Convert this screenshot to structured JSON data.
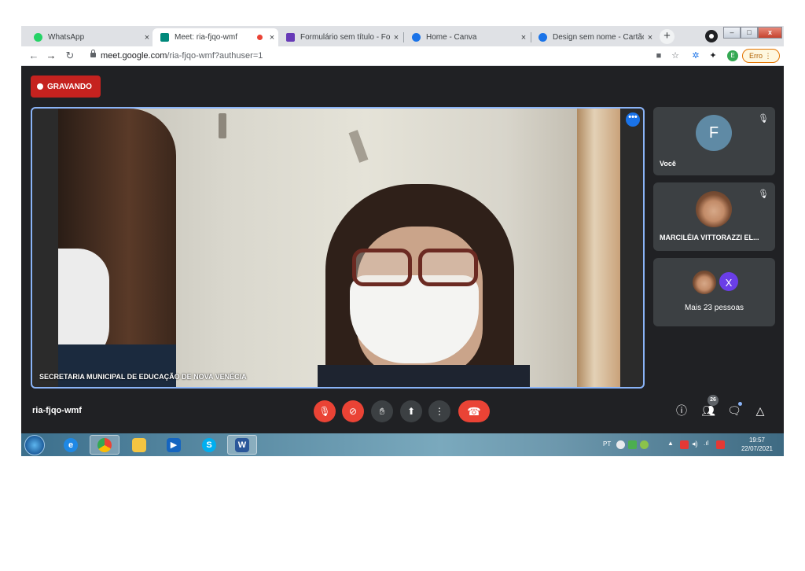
{
  "browser": {
    "tabs": [
      {
        "title": "WhatsApp",
        "icon": "whatsapp-icon",
        "color": "#25d366"
      },
      {
        "title": "Meet: ria-fjqo-wmf",
        "icon": "meet-icon",
        "color": "#00897b",
        "recording": true
      },
      {
        "title": "Formulário sem título - Formul",
        "icon": "forms-icon",
        "color": "#673ab7"
      },
      {
        "title": "Home - Canva",
        "icon": "canva-icon",
        "color": "#00c4cc"
      },
      {
        "title": "Design sem nome - Cartão",
        "icon": "canva-icon",
        "color": "#00c4cc"
      }
    ],
    "close_glyph": "×",
    "new_tab_glyph": "+",
    "window_controls": {
      "minimize": "–",
      "maximize": "□",
      "close": "x"
    },
    "url_host": "meet.google.com",
    "url_path": "/ria-fjqo-wmf?authuser=1",
    "profile_initial": "E",
    "error_chip": "Erro"
  },
  "meet": {
    "recording_label": "GRAVANDO",
    "main_tile_name": "SECRETARIA MUNICIPAL DE EDUCAÇÃO DE NOVA VENÉCIA",
    "main_tile_menu_glyph": "•••",
    "side_tiles": [
      {
        "name": "Você",
        "initial": "F"
      },
      {
        "name": "MARCILÉIA VITTORAZZI EL..."
      },
      {
        "name": "Mais 23 pessoas",
        "initial": "X"
      }
    ],
    "meeting_code": "ria-fjqo-wmf",
    "participant_count": "26",
    "controls": {
      "mic": "mic-off-icon",
      "camera": "camera-off-icon",
      "raise_hand": "raise-hand-icon",
      "present": "present-screen-icon",
      "more": "more-vert-icon",
      "hangup": "hangup-icon"
    },
    "accent": "#8ab4f8",
    "danger": "#ea4335"
  },
  "taskbar": {
    "apps": [
      "ie-icon",
      "chrome-icon",
      "file-explorer-icon",
      "media-player-icon",
      "skype-icon",
      "word-icon"
    ],
    "app_letters": {
      "ie": "e",
      "chrome": "G",
      "media": "▶",
      "skype": "S",
      "word": "W"
    },
    "language": "PT",
    "time": "19:57",
    "date": "22/07/2021"
  }
}
